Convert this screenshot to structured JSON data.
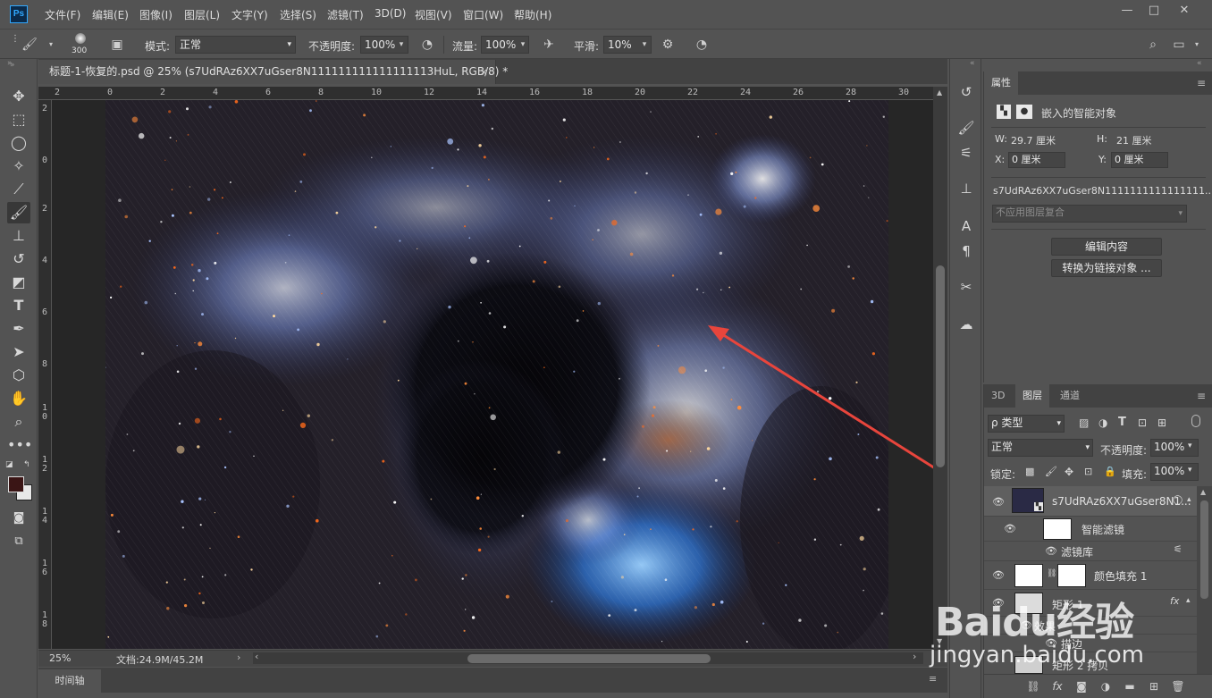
{
  "menubar": {
    "logo": "Ps",
    "items": [
      "文件(F)",
      "编辑(E)",
      "图像(I)",
      "图层(L)",
      "文字(Y)",
      "选择(S)",
      "滤镜(T)",
      "3D(D)",
      "视图(V)",
      "窗口(W)",
      "帮助(H)"
    ],
    "window_buttons": [
      "—",
      "□",
      "✕"
    ]
  },
  "options": {
    "brush_size": "300",
    "mode_label": "模式:",
    "mode_value": "正常",
    "opacity_label": "不透明度:",
    "opacity_value": "100%",
    "flow_label": "流量:",
    "flow_value": "100%",
    "smoothing_label": "平滑:",
    "smoothing_value": "10%"
  },
  "document": {
    "tab_title": "标题-1-恢复的.psd @ 25% (s7UdRAz6XX7uGser8N111111111111111113HuL, RGB/8) *",
    "tab_close": "×",
    "ruler_h": [
      "2",
      "0",
      "2",
      "4",
      "6",
      "8",
      "10",
      "12",
      "14",
      "16",
      "18",
      "20",
      "22",
      "24",
      "26",
      "28",
      "30"
    ],
    "ruler_v": [
      "2",
      "0",
      "2",
      "4",
      "6",
      "8",
      "1\n0",
      "1\n2",
      "1\n4",
      "1\n6",
      "1\n8",
      "2\n0"
    ],
    "zoom": "25%",
    "doc_size": "文档:24.9M/45.2M",
    "timeline_tab": "时间轴"
  },
  "properties": {
    "tab": "属性",
    "type": "嵌入的智能对象",
    "w_label": "W:",
    "w_value": "29.7 厘米",
    "h_label": "H:",
    "h_value": "21 厘米",
    "x_label": "X:",
    "x_value": "0 厘米",
    "y_label": "Y:",
    "y_value": "0 厘米",
    "object_name": "s7UdRAz6XX7uGser8N1111111111111111...",
    "comp_placeholder": "不应用图层复合",
    "edit_contents": "编辑内容",
    "convert_linked": "转换为链接对象 ..."
  },
  "layers": {
    "tabs": [
      "3D",
      "图层",
      "通道"
    ],
    "filter_kind": "ρ 类型",
    "blend_mode": "正常",
    "opacity_label": "不透明度:",
    "opacity_value": "100%",
    "lock_label": "锁定:",
    "fill_label": "填充:",
    "fill_value": "100%",
    "rows": {
      "smart_object": "s7UdRAz6XX7uGser8N1...",
      "smart_filters": "智能滤镜",
      "filter_gallery": "滤镜库",
      "color_fill": "颜色填充 1",
      "shape": "矩形 1",
      "effects": "效果",
      "stroke": "描边",
      "shape2": "矩形 2 拷贝",
      "fx": "fx"
    }
  },
  "watermark": {
    "brand": "Baidu经验",
    "url": "jingyan.baidu.com"
  },
  "colors": {
    "foreground": "#3a1515",
    "background": "#e8e8e8",
    "arrow": "#e8453c"
  }
}
